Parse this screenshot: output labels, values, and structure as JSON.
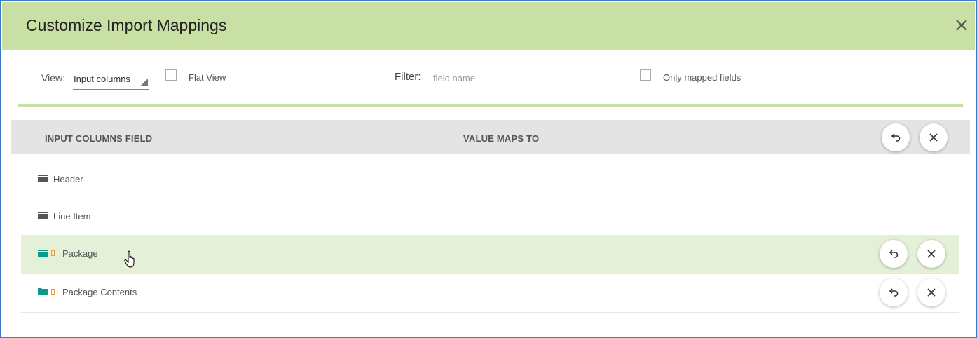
{
  "dialog": {
    "title": "Customize Import Mappings",
    "close_icon": "close-icon"
  },
  "toolbar": {
    "view_label": "View:",
    "view_value": "Input columns",
    "flat_view_label": "Flat View",
    "flat_view_checked": false,
    "filter_label": "Filter:",
    "filter_placeholder": "field name",
    "filter_value": "",
    "only_mapped_label": "Only mapped fields",
    "only_mapped_checked": false
  },
  "grid": {
    "col_field": "INPUT COLUMNS FIELD",
    "col_maps_to": "VALUE MAPS TO",
    "header_icons": [
      "undo-icon",
      "close-icon"
    ],
    "rows": [
      {
        "label": "Header",
        "icon": "folder-icon",
        "mapped": false,
        "selected": false
      },
      {
        "label": "Line Item",
        "icon": "folder-icon",
        "mapped": false,
        "selected": false
      },
      {
        "label": "Package",
        "icon": "folder-icon",
        "mapped": true,
        "selected": true
      },
      {
        "label": "Package Contents",
        "icon": "folder-icon",
        "mapped": true,
        "selected": false
      }
    ]
  },
  "colors": {
    "titlebar": "#c8e0a4",
    "selected_row": "#e5f0d8",
    "folder_default": "#555555",
    "folder_mapped": "#0a9a8a",
    "mapped_marker": "#f0a030",
    "border_blue": "#3c78c8"
  }
}
